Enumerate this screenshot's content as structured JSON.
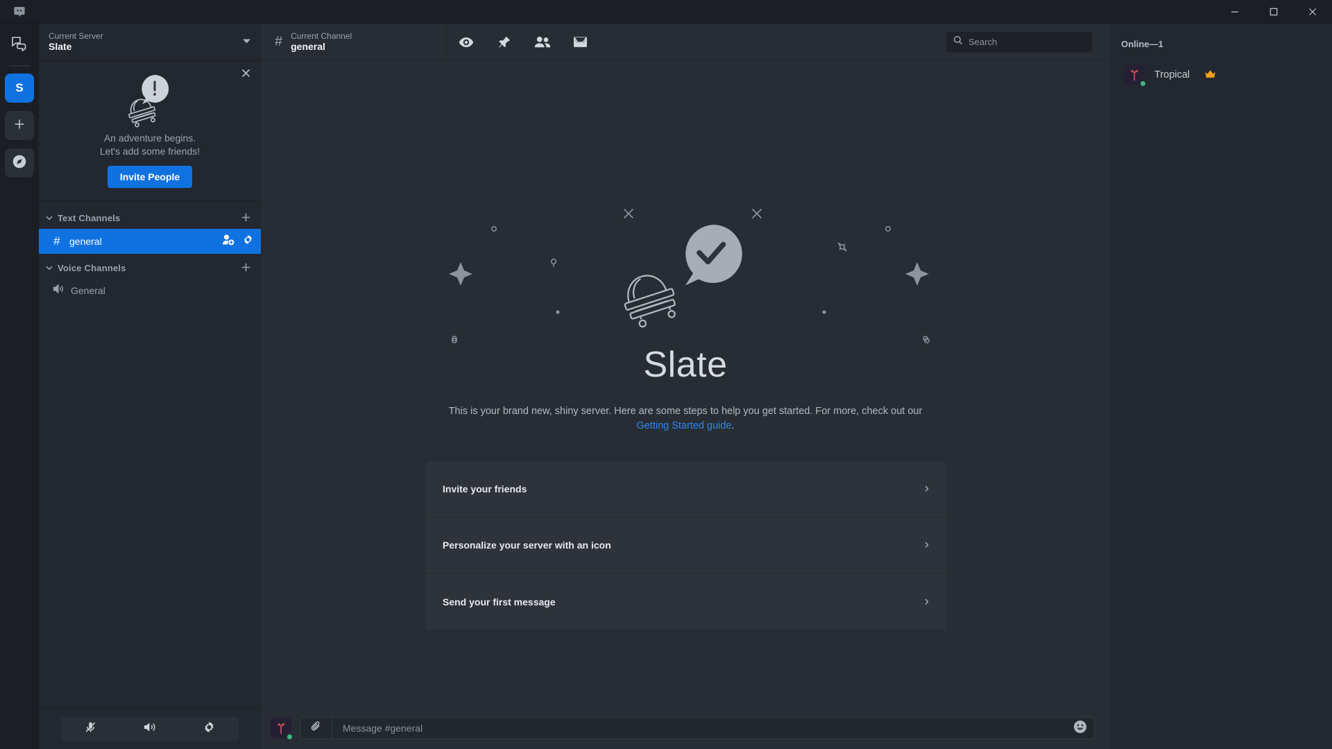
{
  "titlebar": {
    "app_icon": "discord-logo-icon",
    "minimize": "—",
    "maximize": "☐",
    "close": "✕"
  },
  "rail": {
    "items": [
      {
        "name": "direct-messages",
        "icon": "chat-bubbles-icon",
        "label": ""
      },
      {
        "name": "server-slate",
        "icon": "server-initial",
        "label": "S",
        "active": true
      },
      {
        "name": "add-server",
        "icon": "plus-icon",
        "label": "+"
      },
      {
        "name": "explore-servers",
        "icon": "compass-icon",
        "label": ""
      }
    ]
  },
  "sidebar": {
    "server_header": {
      "subtitle": "Current Server",
      "name": "Slate",
      "caret": "▾"
    },
    "invite_panel": {
      "close": "✕",
      "line1": "An adventure begins.",
      "line2": "Let's add some friends!",
      "button": "Invite People"
    },
    "categories": [
      {
        "label": "Text Channels",
        "caret": "⌄",
        "add": "+",
        "channels": [
          {
            "name": "general",
            "prefix": "#",
            "selected": true,
            "actions": [
              "add-member-icon",
              "gear-icon"
            ]
          }
        ]
      },
      {
        "label": "Voice Channels",
        "caret": "⌄",
        "add": "+",
        "channels": [
          {
            "name": "General",
            "prefix": "speaker-icon",
            "selected": false,
            "actions": []
          }
        ]
      }
    ],
    "user_controls": [
      {
        "name": "mute-microphone",
        "icon": "microphone-muted-icon"
      },
      {
        "name": "deafen",
        "icon": "speaker-icon"
      },
      {
        "name": "user-settings",
        "icon": "gear-icon"
      }
    ]
  },
  "channel_header": {
    "hash": "#",
    "subtitle": "Current Channel",
    "name": "general",
    "icons": [
      {
        "name": "hide-channel-icon",
        "title": "eye-icon"
      },
      {
        "name": "pinned-messages-icon",
        "title": "pin-icon"
      },
      {
        "name": "member-list-icon",
        "title": "people-icon"
      },
      {
        "name": "inbox-icon",
        "title": "inbox-icon"
      }
    ],
    "search": {
      "placeholder": "Search",
      "icon": "search-icon"
    }
  },
  "welcome": {
    "title": "Slate",
    "description": "This is your brand new, shiny server. Here are some steps to help you get started. For more, check out our",
    "link_text": "Getting Started guide",
    "description_end": ".",
    "cards": [
      {
        "label": "Invite your friends",
        "chevron": "›"
      },
      {
        "label": "Personalize your server with an icon",
        "chevron": "›"
      },
      {
        "label": "Send your first message",
        "chevron": "›"
      }
    ]
  },
  "composer": {
    "avatar_icon": "palm-tree-avatar",
    "attach_icon": "paperclip-icon",
    "placeholder": "Message #general",
    "emoji_icon": "smiley-icon"
  },
  "members": {
    "header": "Online—1",
    "list": [
      {
        "name": "Tropical",
        "badge": "👑",
        "avatar_icon": "palm-tree-avatar",
        "status": "online"
      }
    ]
  },
  "colors": {
    "accent": "#0f72e0",
    "link": "#2f87e8",
    "online": "#3aba7d",
    "sidebar_bg": "#232830",
    "main_bg": "#282d35",
    "rail_bg": "#1b1f24",
    "card_bg": "#2e333b"
  }
}
